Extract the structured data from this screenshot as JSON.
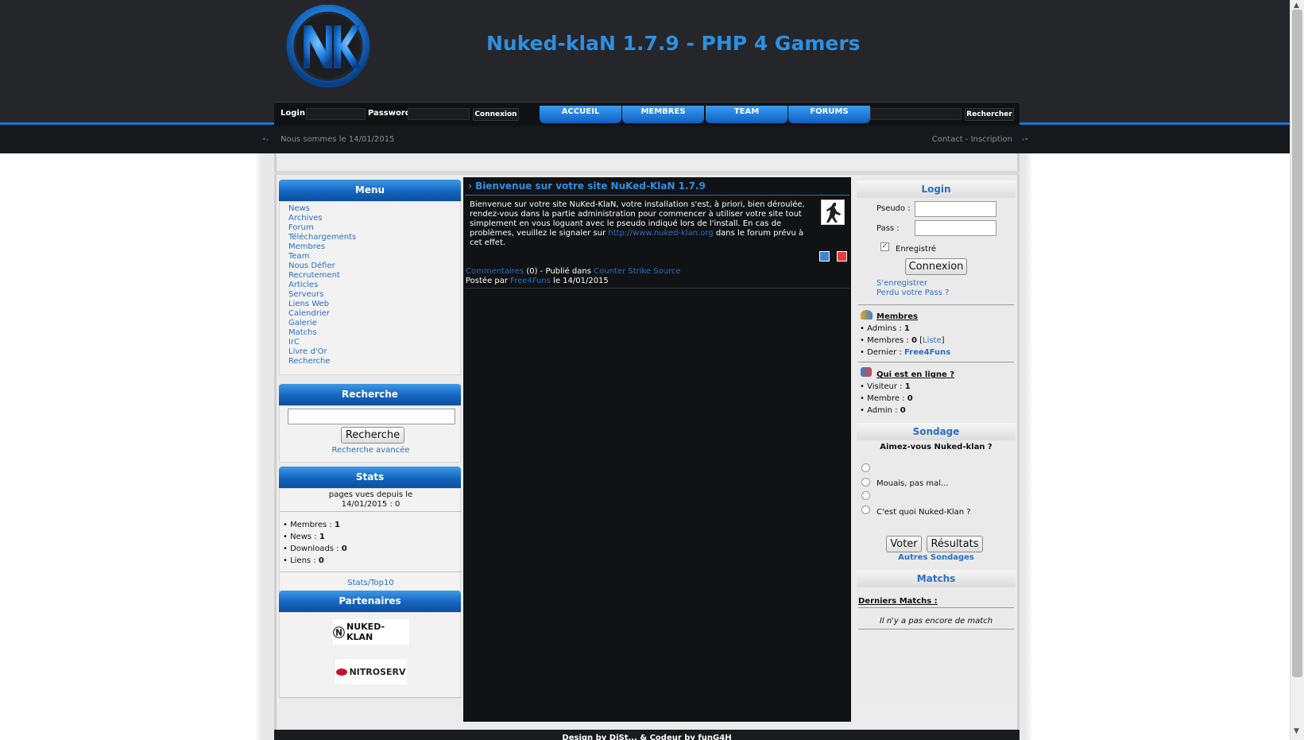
{
  "header": {
    "site_title": "Nuked-klaN 1.7.9 - PHP 4 Gamers",
    "date_text": "Nous sommes le 14/01/2015",
    "contact_links": "Contact - Inscription"
  },
  "navbar": {
    "login_label": "Login :",
    "password_label": "Password :",
    "connect_label": "Connexion",
    "tabs": [
      "ACCUEIL",
      "MEMBRES",
      "TEAM",
      "FORUMS"
    ],
    "search_label": "Rechercher"
  },
  "menu": {
    "title": "Menu",
    "items": [
      "News",
      "Archives",
      "Forum",
      "Téléchargements",
      "Membres",
      "Team",
      "Nous Défier",
      "Recrutement",
      "Articles",
      "Serveurs",
      "Liens Web",
      "Calendrier",
      "Galerie",
      "Matchs",
      "IrC",
      "Livre d'Or",
      "Recherche"
    ]
  },
  "search_block": {
    "title": "Recherche",
    "button": "Recherche",
    "advanced": "Recherche avancée"
  },
  "stats": {
    "title": "Stats",
    "pages_line1": "pages vues depuis le",
    "pages_line2": "14/01/2015 : 0",
    "rows": [
      {
        "label": "Membres :",
        "value": "1"
      },
      {
        "label": "News :",
        "value": "1"
      },
      {
        "label": "Downloads :",
        "value": "0"
      },
      {
        "label": "Liens :",
        "value": "0"
      }
    ],
    "top10": "Stats/Top10"
  },
  "partners": {
    "title": "Partenaires",
    "logos": [
      "NUKED-KLAN",
      "NITROSERV"
    ]
  },
  "news": {
    "title": "Bienvenue sur votre site NuKed-KlaN 1.7.9",
    "body_before": "Bienvenue sur votre site NuKed-KlaN, votre installation s'est, à priori, bien déroulée, rendez-vous dans la partie administration pour commencer à utiliser votre site tout simplement en vous loguant avec le pseudo indiqué lors de l'install. En cas de problèmes, veuillez le signaler sur ",
    "link": "http://www.nuked-klan.org",
    "body_after": " dans le forum prévu à cet effet.",
    "comments_link": "Commentaires",
    "comments_count": " (0) - Publié dans ",
    "category_link": "Counter Strike Source",
    "posted_by": "Postée par ",
    "author": "Free4Funs",
    "posted_date": " le 14/01/2015"
  },
  "login_block": {
    "title": "Login",
    "pseudo_label": "Pseudo :",
    "pass_label": "Pass :",
    "remember_label": "Enregistré",
    "connect_button": "Connexion",
    "register_link": "S'enregistrer",
    "lost_pass_link": "Perdu votre Pass ?"
  },
  "members_block": {
    "title": "Membres",
    "admins_label": "Admins :",
    "admins_value": "1",
    "members_label": "Membres :",
    "members_value": "0",
    "list_link": "Liste",
    "last_label": "Dernier :",
    "last_value": "Free4Funs"
  },
  "online_block": {
    "title": "Qui est en ligne ?",
    "visitor_label": "Visiteur :",
    "visitor_value": "1",
    "member_label": "Membre :",
    "member_value": "0",
    "admin_label": "Admin :",
    "admin_value": "0"
  },
  "poll": {
    "title": "Sondage",
    "question": "Aimez-vous Nuked-klan ?",
    "options": [
      "",
      "Mouais, pas mal...",
      "",
      "C'est quoi Nuked-Klan ?"
    ],
    "vote_button": "Voter",
    "results_button": "Résultats",
    "other_polls": "Autres Sondages"
  },
  "matches": {
    "title": "Matchs",
    "last_matches": "Derniers Matchs :",
    "empty_text": "Il n'y a pas encore de match"
  },
  "footer": {
    "text": "Design by DiSt... & Codeur by funG4H"
  },
  "colors": {
    "header_bg": "#24262a",
    "accent_blue": "#2e8fe0",
    "tab_blue": "#1565c0",
    "link_blue": "#2a6fc4",
    "center_bg": "#111214"
  },
  "icons": [
    "nk-logo-icon",
    "counter-strike-icon",
    "send-friend-icon",
    "pdf-icon",
    "members-group-icon",
    "online-users-icon"
  ]
}
